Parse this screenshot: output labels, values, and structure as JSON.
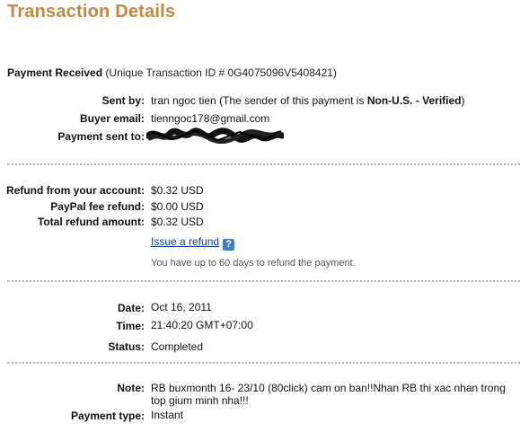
{
  "page_title": "Transaction Details",
  "payment_received": {
    "label": "Payment Received",
    "detail": "(Unique Transaction ID # 0G4075096V5408421)"
  },
  "sender": {
    "sent_by_label": "Sent by:",
    "sent_by_name": "tran ngoc tien",
    "sent_by_note_prefix": "(The sender of this payment is",
    "sent_by_status": "Non-U.S. - Verified",
    "sent_by_note_suffix": ")",
    "buyer_email_label": "Buyer email:",
    "buyer_email": "tienngoc178@gmail.com",
    "payment_sent_to_label": "Payment sent to:"
  },
  "refund": {
    "refund_from_account_label": "Refund from your account:",
    "refund_from_account_value": "$0.32 USD",
    "paypal_fee_refund_label": "PayPal fee refund:",
    "paypal_fee_refund_value": "$0.00 USD",
    "total_refund_label": "Total refund amount:",
    "total_refund_value": "$0.32 USD",
    "issue_refund_link": "Issue a refund",
    "help_icon_glyph": "?",
    "refund_hint": "You have up to 60 days to refund the payment."
  },
  "status_section": {
    "date_label": "Date:",
    "date_value": "Oct 16, 2011",
    "time_label": "Time:",
    "time_value": "21:40:20 GMT+07:00",
    "status_label": "Status:",
    "status_value": "Completed"
  },
  "note_section": {
    "note_label": "Note:",
    "note_value": "RB buxmonth 16- 23/10 (80click) cam on ban!!Nhan RB thi xac nhan trong top gium minh nha!!!",
    "payment_type_label": "Payment type:",
    "payment_type_value": "Instant"
  },
  "colors": {
    "title": "#c0893f",
    "link": "#0b3c9e",
    "help_icon_bg": "#3f7ec1",
    "divider": "#b0b0b0"
  },
  "icons": {
    "help": "question-mark-icon",
    "redaction": "redacted-scribble"
  }
}
